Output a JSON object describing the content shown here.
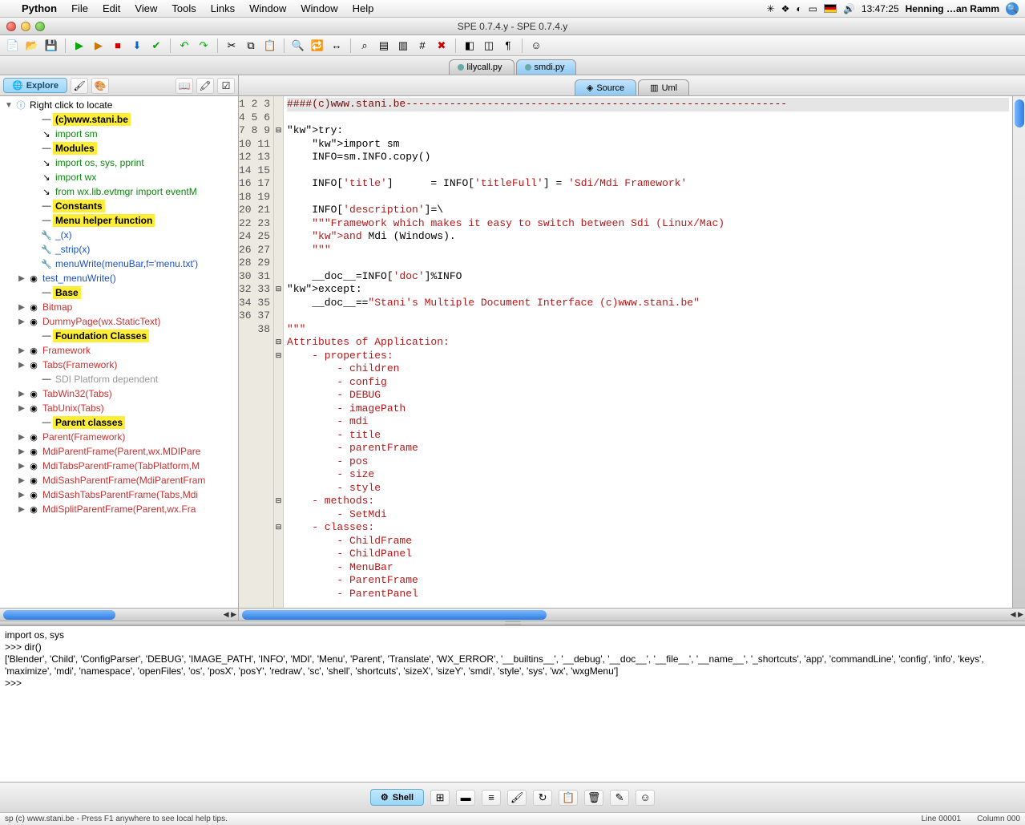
{
  "menubar": {
    "app": "Python",
    "items": [
      "File",
      "Edit",
      "View",
      "Tools",
      "Links",
      "Window",
      "Window",
      "Help"
    ],
    "clock": "13:47:25",
    "user": "Henning …an Ramm"
  },
  "window": {
    "title": "SPE 0.7.4.y - SPE 0.7.4.y"
  },
  "doctabs": [
    {
      "label": "lilycall.py",
      "active": false
    },
    {
      "label": "smdi.py",
      "active": true
    }
  ],
  "left": {
    "explore": "Explore",
    "root": "Right click to locate",
    "nodes": [
      {
        "lbl": "(c)www.stani.be",
        "cls": "hl",
        "ic": "—",
        "ind": 2
      },
      {
        "lbl": "import sm",
        "cls": "import",
        "ic": "↘",
        "ind": 2
      },
      {
        "lbl": "Modules",
        "cls": "hl",
        "ic": "—",
        "ind": 2
      },
      {
        "lbl": "import  os, sys, pprint",
        "cls": "import",
        "ic": "↘",
        "ind": 2
      },
      {
        "lbl": "import  wx",
        "cls": "import",
        "ic": "↘",
        "ind": 2
      },
      {
        "lbl": "from    wx.lib.evtmgr import eventM",
        "cls": "import",
        "ic": "↘",
        "ind": 2
      },
      {
        "lbl": "Constants",
        "cls": "hl",
        "ic": "—",
        "ind": 2
      },
      {
        "lbl": "Menu helper function",
        "cls": "hl",
        "ic": "—",
        "ind": 2
      },
      {
        "lbl": "_(x)",
        "cls": "blue",
        "ic": "🔧",
        "ind": 2
      },
      {
        "lbl": "_strip(x)",
        "cls": "blue",
        "ic": "🔧",
        "ind": 2
      },
      {
        "lbl": "menuWrite(menuBar,f='menu.txt')",
        "cls": "blue",
        "ic": "🔧",
        "ind": 2
      },
      {
        "lbl": "test_menuWrite()",
        "cls": "blue",
        "ic": "◉",
        "ind": 1,
        "tw": "▶"
      },
      {
        "lbl": "Base",
        "cls": "hl",
        "ic": "—",
        "ind": 2
      },
      {
        "lbl": "Bitmap",
        "cls": "red",
        "ic": "◉",
        "ind": 1,
        "tw": "▶"
      },
      {
        "lbl": "DummyPage(wx.StaticText)",
        "cls": "red",
        "ic": "◉",
        "ind": 1,
        "tw": "▶"
      },
      {
        "lbl": "Foundation Classes",
        "cls": "hl",
        "ic": "—",
        "ind": 2
      },
      {
        "lbl": "Framework",
        "cls": "red",
        "ic": "◉",
        "ind": 1,
        "tw": "▶"
      },
      {
        "lbl": "Tabs(Framework)",
        "cls": "red",
        "ic": "◉",
        "ind": 1,
        "tw": "▶"
      },
      {
        "lbl": "SDI Platform dependent",
        "cls": "grey",
        "ic": "—",
        "ind": 2
      },
      {
        "lbl": "TabWin32(Tabs)",
        "cls": "red",
        "ic": "◉",
        "ind": 1,
        "tw": "▶"
      },
      {
        "lbl": "TabUnix(Tabs)",
        "cls": "red",
        "ic": "◉",
        "ind": 1,
        "tw": "▶"
      },
      {
        "lbl": "Parent classes",
        "cls": "hl",
        "ic": "—",
        "ind": 2
      },
      {
        "lbl": "Parent(Framework)",
        "cls": "red",
        "ic": "◉",
        "ind": 1,
        "tw": "▶"
      },
      {
        "lbl": "MdiParentFrame(Parent,wx.MDIPare",
        "cls": "red",
        "ic": "◉",
        "ind": 1,
        "tw": "▶"
      },
      {
        "lbl": "MdiTabsParentFrame(TabPlatform,M",
        "cls": "red",
        "ic": "◉",
        "ind": 1,
        "tw": "▶"
      },
      {
        "lbl": "MdiSashParentFrame(MdiParentFram",
        "cls": "red",
        "ic": "◉",
        "ind": 1,
        "tw": "▶"
      },
      {
        "lbl": "MdiSashTabsParentFrame(Tabs,Mdi",
        "cls": "red",
        "ic": "◉",
        "ind": 1,
        "tw": "▶"
      },
      {
        "lbl": "MdiSplitParentFrame(Parent,wx.Fra",
        "cls": "red",
        "ic": "◉",
        "ind": 1,
        "tw": "▶"
      }
    ]
  },
  "righttabs": [
    {
      "label": "Source",
      "active": true,
      "icon": "◈"
    },
    {
      "label": "Uml",
      "active": false,
      "icon": "▥"
    }
  ],
  "code": {
    "start": 1,
    "end": 38,
    "lines": [
      "####(c)www.stani.be-------------------------------------------------------------",
      "",
      "try:",
      "    import sm",
      "    INFO=sm.INFO.copy()",
      "",
      "    INFO['title']      = INFO['titleFull'] = 'Sdi/Mdi Framework'",
      "",
      "    INFO['description']=\\",
      "    \"\"\"Framework which makes it easy to switch between Sdi (Linux/Mac)",
      "    and Mdi (Windows).",
      "    \"\"\"",
      "",
      "    __doc__=INFO['doc']%INFO",
      "except:",
      "    __doc__==\"Stani's Multiple Document Interface (c)www.stani.be\"",
      "",
      "\"\"\"",
      "Attributes of Application:",
      "    - properties:",
      "        - children",
      "        - config",
      "        - DEBUG",
      "        - imagePath",
      "        - mdi",
      "        - title",
      "        - parentFrame",
      "        - pos",
      "        - size",
      "        - style",
      "    - methods:",
      "        - SetMdi",
      "    - classes:",
      "        - ChildFrame",
      "        - ChildPanel",
      "        - MenuBar",
      "        - ParentFrame",
      "        - ParentPanel"
    ]
  },
  "console": {
    "l1": "import os, sys",
    "l2": ">>> dir()",
    "l3": "['Blender', 'Child', 'ConfigParser', 'DEBUG', 'IMAGE_PATH', 'INFO', 'MDI', 'Menu', 'Parent', 'Translate', 'WX_ERROR', '__builtins__', '__debug', '__doc__', '__file__', '__name__', '_shortcuts', 'app', 'commandLine', 'config', 'info', 'keys', 'maximize', 'mdi', 'namespace', 'openFiles', 'os', 'posX', 'posY', 'redraw', 'sc', 'shell', 'shortcuts', 'sizeX', 'sizeY', 'smdi', 'style', 'sys', 'wx', 'wxgMenu']",
    "l4": ">>> "
  },
  "bottombar": {
    "shell": "Shell"
  },
  "status": {
    "left": "sp   (c) www.stani.be - Press F1 anywhere to see local help tips.",
    "line": "Line 00001",
    "col": "Column 000"
  }
}
